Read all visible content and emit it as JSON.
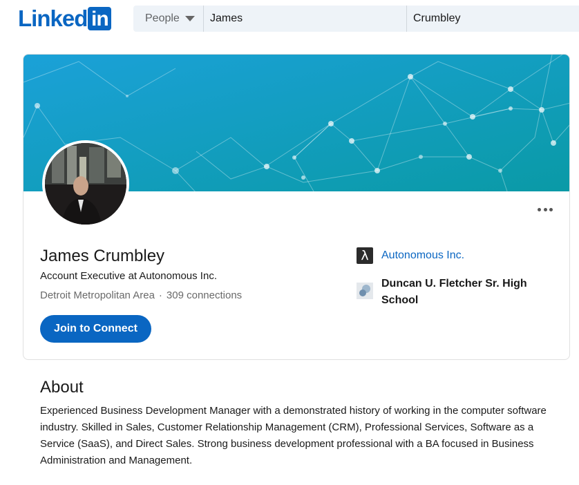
{
  "header": {
    "logo_text": "Linked",
    "logo_in": "in",
    "search_type": "People",
    "first_name": "James",
    "last_name": "Crumbley"
  },
  "profile": {
    "name": "James Crumbley",
    "headline": "Account Executive at Autonomous Inc.",
    "location": "Detroit Metropolitan Area",
    "separator": "·",
    "connections": "309 connections",
    "join_button": "Join to Connect",
    "company": "Autonomous Inc.",
    "company_logo_glyph": "λ",
    "school": "Duncan U. Fletcher Sr. High School"
  },
  "about": {
    "title": "About",
    "text": "Experienced Business Development Manager with a demonstrated history of working in the computer software industry. Skilled in Sales, Customer Relationship Management (CRM), Professional Services, Software as a Service (SaaS), and Direct Sales. Strong business development professional with a BA focused in Business Administration and Management."
  },
  "colors": {
    "brand": "#0a66c2",
    "banner_start": "#1aa0d6",
    "banner_end": "#0b9aa8"
  },
  "icons": {
    "more": "more-icon",
    "caret": "chevron-down-icon"
  }
}
